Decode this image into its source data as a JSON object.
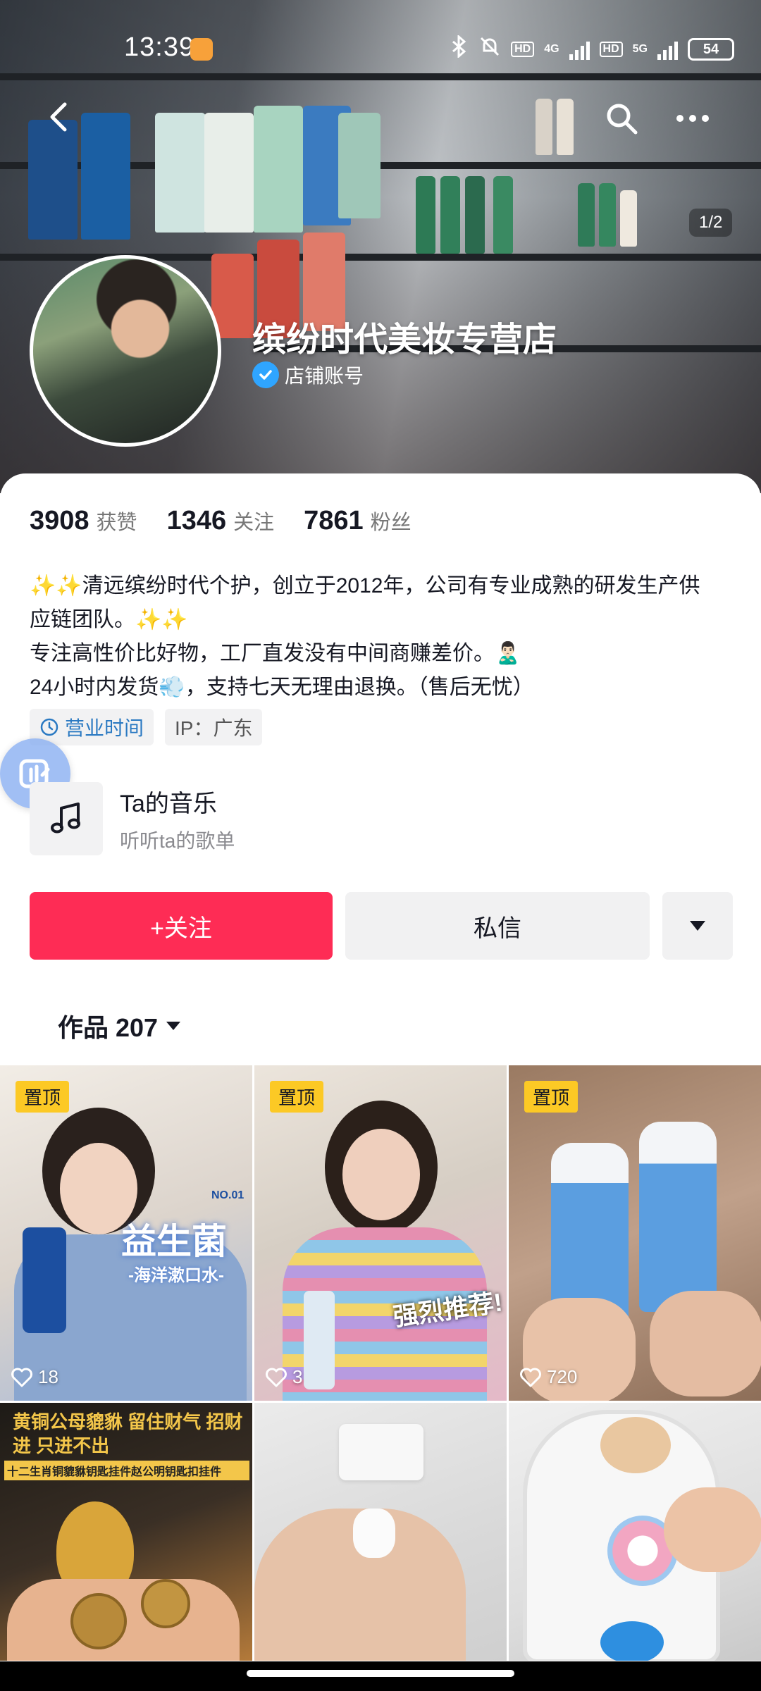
{
  "status_bar": {
    "time": "13:39",
    "network_4g": "4G",
    "network_5g": "5G",
    "hd1": "HD",
    "hd2": "HD",
    "battery": "54"
  },
  "header": {
    "pager": "1/2",
    "shop_name": "缤纷时代美妆专营店",
    "verify_label": "店铺账号"
  },
  "stats": [
    {
      "value": "3908",
      "label": "获赞"
    },
    {
      "value": "1346",
      "label": "关注"
    },
    {
      "value": "7861",
      "label": "粉丝"
    }
  ],
  "bio": {
    "line1": "✨✨清远缤纷时代个护，创立于2012年，公司有专业成熟的研发生产供",
    "line2": "应链团队。✨✨",
    "line3": "专注高性价比好物，工厂直发没有中间商赚差价。🙎🏻‍♂️",
    "line4": "24小时内发货💨，支持七天无理由退换。（售后无忧）"
  },
  "tags": {
    "hours": "营业时间",
    "ip": "IP：广东"
  },
  "music": {
    "title": "Ta的音乐",
    "subtitle": "听听ta的歌单"
  },
  "actions": {
    "follow": "+关注",
    "message": "私信"
  },
  "works": {
    "label": "作品 207"
  },
  "grid": [
    {
      "pinned": "置顶",
      "likes": "18",
      "caption": "益生菌",
      "sub": "-海洋漱口水-",
      "badge": "NO.01"
    },
    {
      "pinned": "置顶",
      "likes": "3",
      "caption": "强烈推荐!"
    },
    {
      "pinned": "置顶",
      "likes": "720"
    },
    {
      "caption": "黄铜公母貔貅 留住财气 招财进 只进不出",
      "sub": "十二生肖铜貔貅钥匙挂件赵公明钥匙扣挂件"
    },
    {},
    {}
  ],
  "colors": {
    "accent": "#fe2c55",
    "pin": "#fcc925",
    "verify": "#2fa5ff"
  }
}
